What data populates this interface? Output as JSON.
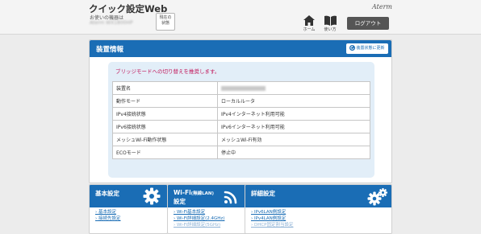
{
  "header": {
    "app_title": "クイック設定Web",
    "device_caption": "お使いの機器は",
    "device_name": "Aterm WX1800HP",
    "status_button": [
      "現在の",
      "状態"
    ],
    "brand": "Aterm",
    "nav": [
      {
        "label": "ホーム",
        "icon": "home-icon"
      },
      {
        "label": "使い方",
        "icon": "book-icon"
      }
    ],
    "logout_label": "ログアウト"
  },
  "panel": {
    "title": "装置情報",
    "refresh_label": "装置状態に更新",
    "notice": "ブリッジモードへの切り替えを推奨します。",
    "rows": [
      {
        "label": "装置名",
        "value": ""
      },
      {
        "label": "動作モード",
        "value": "ローカルルータ"
      },
      {
        "label": "IPv4接続状態",
        "value": "IPv4インターネット利用可能"
      },
      {
        "label": "IPv6接続状態",
        "value": "IPv6インターネット利用可能"
      },
      {
        "label": "メッシュWi-Fi動作状態",
        "value": "メッシュWi-Fi有効"
      },
      {
        "label": "ECOモード",
        "value": "停止中"
      }
    ]
  },
  "cards": [
    {
      "title": "基本設定",
      "icon": "gear-icon",
      "links": [
        "基本設定",
        "接続先設定"
      ]
    },
    {
      "title": "Wi-Fi",
      "title_sub": "(無線LAN)",
      "title_line2": "設定",
      "icon": "wifi-icon",
      "links": [
        "Wi-Fi基本設定",
        "Wi-Fi詳細設定(2.4GHz)",
        "Wi-Fi詳細設定(5GHz)"
      ]
    },
    {
      "title": "詳細設定",
      "icon": "gears-icon",
      "links": [
        "IPv6LAN側設定",
        "IPv4LAN側設定",
        "DHCP固定割当設定"
      ]
    }
  ],
  "colors": {
    "accent": "#1a6db5",
    "notice": "#c2185b",
    "header_bg": "#f4f4f4",
    "page_bg": "#ececec"
  }
}
